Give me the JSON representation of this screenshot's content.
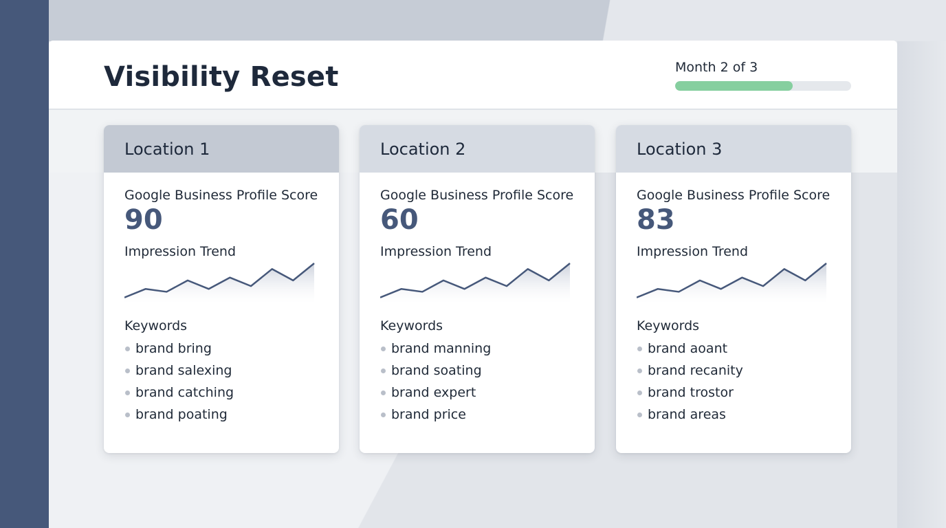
{
  "header": {
    "title": "Visibility Reset",
    "progress_label": "Month 2 of 3",
    "progress_fraction": 0.667,
    "progress_color": "#86cf9f"
  },
  "accent_color": "#46587a",
  "locations": [
    {
      "name": "Location 1",
      "score_label": "Google Business Profile Score",
      "score": "90",
      "trend_label": "Impression Trend",
      "trend": [
        2,
        5,
        4,
        8,
        5,
        9,
        6,
        12,
        8,
        14
      ],
      "keywords_label": "Keywords",
      "keywords": [
        "brand bring",
        "brand salexing",
        "brand catching",
        "brand poating"
      ]
    },
    {
      "name": "Location 2",
      "score_label": "Google Business Profile Score",
      "score": "60",
      "trend_label": "Impression Trend",
      "trend": [
        2,
        5,
        4,
        8,
        5,
        9,
        6,
        12,
        8,
        14
      ],
      "keywords_label": "Keywords",
      "keywords": [
        "brand manning",
        "brand soating",
        "brand expert",
        "brand price"
      ]
    },
    {
      "name": "Location 3",
      "score_label": "Google Business Profile Score",
      "score": "83",
      "trend_label": "Impression Trend",
      "trend": [
        2,
        5,
        4,
        8,
        5,
        9,
        6,
        12,
        8,
        14
      ],
      "keywords_label": "Keywords",
      "keywords": [
        "brand aoant",
        "brand recanity",
        "brand trostor",
        "brand areas"
      ]
    }
  ]
}
